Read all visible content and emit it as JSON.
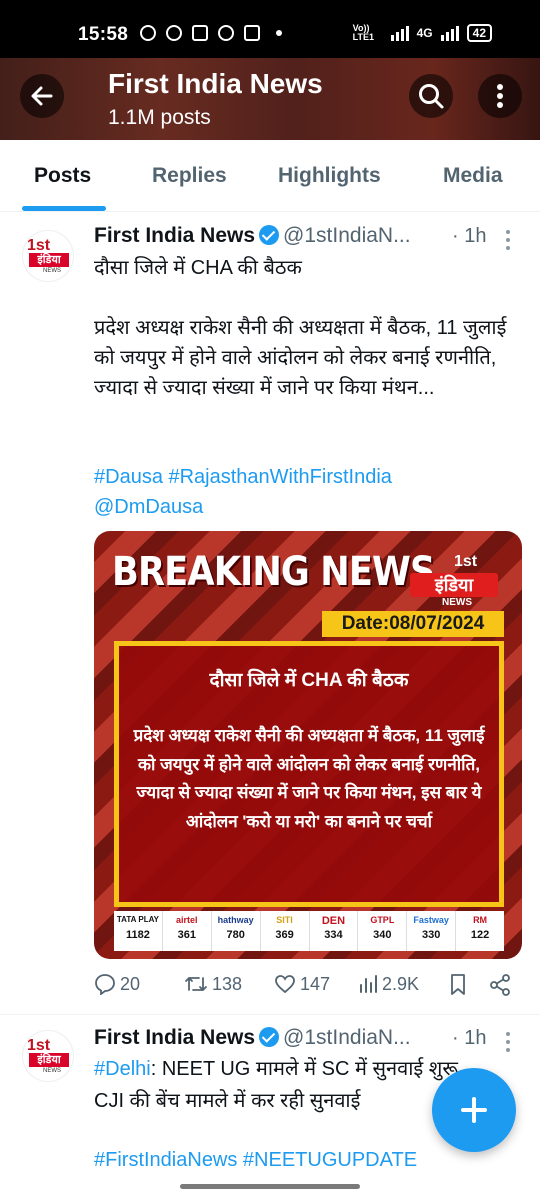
{
  "status_bar": {
    "time": "15:58",
    "net1": "Vo)) LTE1",
    "net2": "4G",
    "battery": "42"
  },
  "header": {
    "title": "First India News",
    "subtitle": "1.1M posts"
  },
  "tabs": [
    "Posts",
    "Replies",
    "Highlights",
    "Media"
  ],
  "accent_color": "#1d9bf0",
  "tweet1": {
    "name": "First India News",
    "handle": "@1stIndiaN...",
    "time": "· 1h",
    "line1": "दौसा जिले में CHA की बैठक",
    "body": "प्रदेश अध्यक्ष राकेश सैनी की अध्यक्षता में बैठक, 11 जुलाई को जयपुर में होने वाले आंदोलन को लेकर बनाई रणनीति, ज्यादा से ज्यादा संख्या में जाने पर किया मंथन...",
    "hashtags": "#Dausa #RajasthanWithFirstIndia",
    "mention": "@DmDausa",
    "image": {
      "headline": "BREAKING NEWS",
      "logo_num": "1st",
      "logo_name": "इंडिया",
      "logo_sub": "NEWS",
      "date": "Date:08/07/2024",
      "box_title": "दौसा जिले में CHA की बैठक",
      "box_body": "प्रदेश अध्यक्ष राकेश सैनी की अध्यक्षता में बैठक, 11 जुलाई को जयपुर में होने वाले आंदोलन को लेकर बनाई रणनीति, ज्यादा से ज्यादा संख्या में जाने पर किया मंथन, इस बार ये आंदोलन 'करो या मरो' का बनाने पर चर्चा",
      "channels": [
        {
          "name": "TATA PLAY",
          "num": "1182"
        },
        {
          "name": "airtel",
          "num": "361"
        },
        {
          "name": "hathway",
          "num": "780"
        },
        {
          "name": "SITI",
          "num": "369"
        },
        {
          "name": "DEN",
          "num": "334"
        },
        {
          "name": "GTPL",
          "num": "340"
        },
        {
          "name": "Fastway",
          "num": "330"
        },
        {
          "name": "RM",
          "num": "122"
        }
      ]
    },
    "stats": {
      "replies": "20",
      "reposts": "138",
      "likes": "147",
      "views": "2.9K"
    }
  },
  "tweet2": {
    "name": "First India News",
    "handle": "@1stIndiaN...",
    "time": "· 1h",
    "hashtag": "#Delhi",
    "line1": ": NEET UG मामले में SC में सुनवाई शुरू",
    "line2": "CJI की बेंच मामले में कर रही सुनवाई",
    "hashtags": "#FirstIndiaNews #NEETUGUPDATE"
  },
  "avatar": {
    "num": "1st",
    "name": "इंडिया",
    "sub": "NEWS"
  }
}
